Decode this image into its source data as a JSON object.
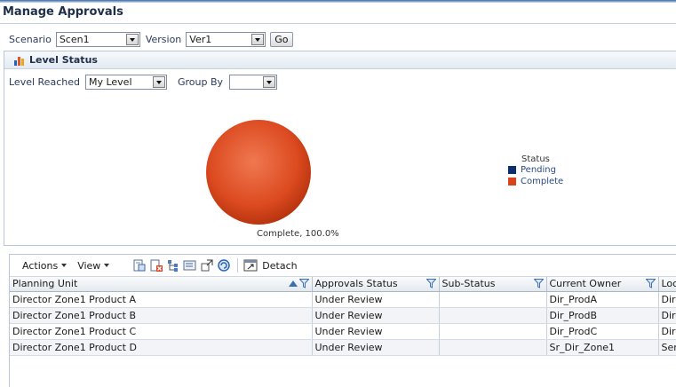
{
  "page": {
    "title": "Manage Approvals"
  },
  "filters": {
    "scenario_label": "Scenario",
    "scenario_value": "Scen1",
    "version_label": "Version",
    "version_value": "Ver1",
    "go_label": "Go"
  },
  "level_status": {
    "title": "Level Status",
    "level_reached_label": "Level Reached",
    "level_reached_value": "My Level",
    "group_by_label": "Group By",
    "group_by_value": ""
  },
  "chart_data": {
    "type": "pie",
    "categories": [
      "Pending",
      "Complete"
    ],
    "values": [
      0,
      100
    ],
    "colors": [
      "#0b2f6e",
      "#d9441a"
    ],
    "data_label": "Complete, 100.0%",
    "legend_title": "Status",
    "legend_position": "right"
  },
  "toolbar": {
    "actions_label": "Actions",
    "view_label": "View",
    "detach_label": "Detach"
  },
  "table": {
    "columns": [
      "Planning Unit",
      "Approvals Status",
      "Sub-Status",
      "Current Owner",
      "Loca"
    ],
    "rows": [
      [
        "Director Zone1 Product A",
        "Under Review",
        "",
        "Dir_ProdA",
        "Dire"
      ],
      [
        "Director Zone1 Product B",
        "Under Review",
        "",
        "Dir_ProdB",
        "Dire"
      ],
      [
        "Director Zone1 Product C",
        "Under Review",
        "",
        "Dir_ProdC",
        "Dire"
      ],
      [
        "Director Zone1 Product D",
        "Under Review",
        "",
        "Sr_Dir_Zone1",
        "Sen"
      ]
    ]
  },
  "icons": {
    "panel": "bar-chart-icon",
    "sort": "sort-ascending-icon",
    "filter": "filter-funnel-icon",
    "toolbar": [
      "export-icon",
      "delete-icon",
      "hierarchy-icon",
      "edit-icon",
      "expand-icon",
      "refresh-icon",
      "detach-icon"
    ]
  }
}
